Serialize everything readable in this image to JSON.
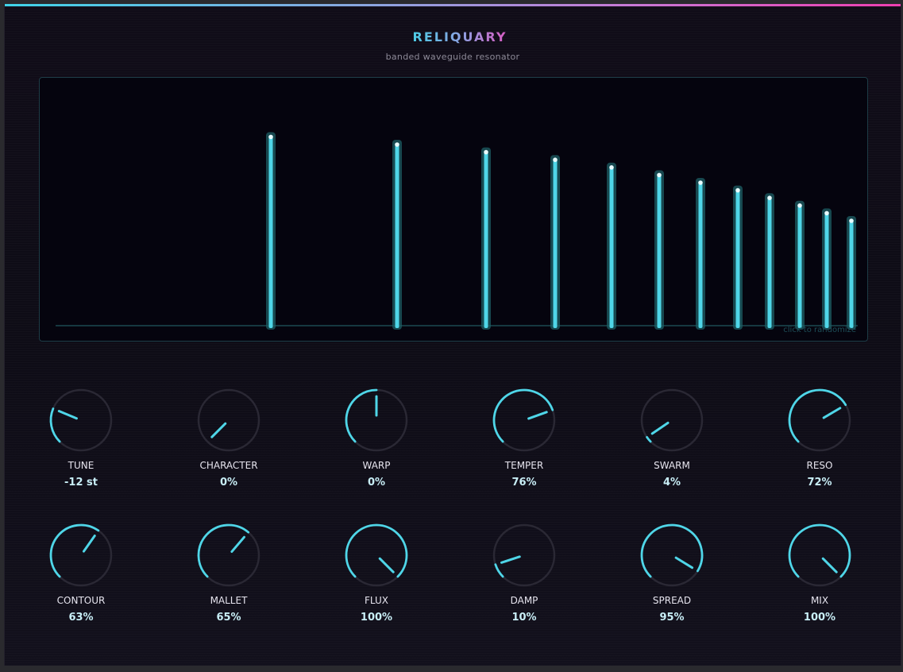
{
  "app": {
    "title": "RELIQUARY",
    "subtitle": "banded waveguide resonator"
  },
  "colors": {
    "accent": "#4fd6e8",
    "accent_dim": "#1d5f66",
    "ring": "#2a2834",
    "bg": "#05040e"
  },
  "display": {
    "hint": "click to randomize",
    "modes_note": "12 resonator mode bars, heights as fraction of full scale",
    "modes": [
      0.99,
      0.95,
      0.91,
      0.87,
      0.83,
      0.79,
      0.75,
      0.71,
      0.67,
      0.63,
      0.59,
      0.55
    ]
  },
  "knobs_row1": [
    {
      "name": "tune",
      "label": "TUNE",
      "value": "-12 st",
      "fraction": 0.25
    },
    {
      "name": "character",
      "label": "CHARACTER",
      "value": "0%",
      "fraction": 0.0
    },
    {
      "name": "warp",
      "label": "WARP",
      "value": "0%",
      "fraction": 0.5
    },
    {
      "name": "temper",
      "label": "TEMPER",
      "value": "76%",
      "fraction": 0.76
    },
    {
      "name": "swarm",
      "label": "SWARM",
      "value": "4%",
      "fraction": 0.04
    },
    {
      "name": "reso",
      "label": "RESO",
      "value": "72%",
      "fraction": 0.72
    }
  ],
  "knobs_row2": [
    {
      "name": "contour",
      "label": "CONTOUR",
      "value": "63%",
      "fraction": 0.63
    },
    {
      "name": "mallet",
      "label": "MALLET",
      "value": "65%",
      "fraction": 0.65
    },
    {
      "name": "flux",
      "label": "FLUX",
      "value": "100%",
      "fraction": 1.0
    },
    {
      "name": "damp",
      "label": "DAMP",
      "value": "10%",
      "fraction": 0.1
    },
    {
      "name": "spread",
      "label": "SPREAD",
      "value": "95%",
      "fraction": 0.95
    },
    {
      "name": "mix",
      "label": "MIX",
      "value": "100%",
      "fraction": 1.0
    }
  ]
}
